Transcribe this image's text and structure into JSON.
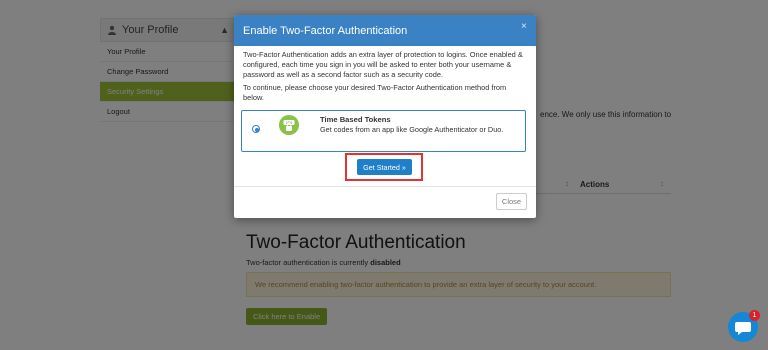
{
  "sidebar": {
    "title": "Your Profile",
    "items": [
      {
        "label": "Your Profile"
      },
      {
        "label": "Change Password"
      },
      {
        "label": "Security Settings"
      },
      {
        "label": "Logout"
      }
    ]
  },
  "background": {
    "partial_text": "ence. We only use this information to",
    "table_header_actions": "Actions",
    "tfa_title": "Two-Factor Authentication",
    "tfa_status_prefix": "Two-factor authentication is currently",
    "tfa_status_value": "disabled",
    "tfa_alert": "We recommend enabling two-factor authentication to provide an extra layer of security to your account.",
    "enable_button": "Click here to Enable"
  },
  "modal": {
    "title": "Enable Two-Factor Authentication",
    "close_symbol": "×",
    "paragraph1": "Two-Factor Authentication adds an extra layer of protection to logins. Once enabled & configured, each time you sign in you will be asked to enter both your username & password as well as a second factor such as a security code.",
    "paragraph2": "To continue, please choose your desired Two-Factor Authentication method from below.",
    "method": {
      "title": "Time Based Tokens",
      "description": "Get codes from an app like Google Authenticator or Duo.",
      "icon_text": "2FA",
      "selected": true
    },
    "start_button": "Get Started »",
    "close_button": "Close"
  },
  "chat_widget": {
    "badge_count": "1"
  },
  "colors": {
    "modal_header": "#3a82c4",
    "primary_button": "#1f7fc9",
    "sidebar_active": "#a1c33a",
    "highlight": "#e23232",
    "enable_button": "#8ab030"
  }
}
